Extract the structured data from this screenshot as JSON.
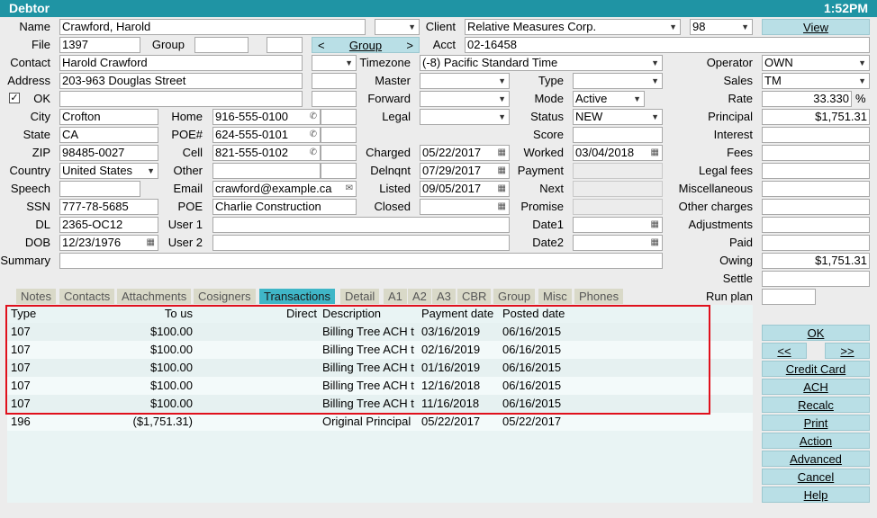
{
  "window": {
    "title": "Debtor",
    "clock": "1:52PM",
    "close": "×"
  },
  "labels": {
    "name": "Name",
    "file": "File",
    "group": "Group",
    "contact": "Contact",
    "address": "Address",
    "ok": "OK",
    "city": "City",
    "state": "State",
    "zip": "ZIP",
    "country": "Country",
    "speech": "Speech",
    "ssn": "SSN",
    "dl": "DL",
    "dob": "DOB",
    "summary": "Summary",
    "home": "Home",
    "poe_num": "POE#",
    "cell": "Cell",
    "other": "Other",
    "email": "Email",
    "poe": "POE",
    "user1": "User 1",
    "user2": "User 2",
    "client": "Client",
    "acct": "Acct",
    "timezone": "Timezone",
    "master": "Master",
    "forward": "Forward",
    "legal": "Legal",
    "charged": "Charged",
    "delnqnt": "Delnqnt",
    "listed": "Listed",
    "closed": "Closed",
    "type": "Type",
    "mode": "Mode",
    "status": "Status",
    "score": "Score",
    "worked": "Worked",
    "payment": "Payment",
    "next": "Next",
    "promise": "Promise",
    "date1": "Date1",
    "date2": "Date2",
    "operator": "Operator",
    "sales": "Sales",
    "rate": "Rate",
    "principal": "Principal",
    "interest": "Interest",
    "fees": "Fees",
    "legal_fees": "Legal fees",
    "miscellaneous": "Miscellaneous",
    "other_charges": "Other charges",
    "adjustments": "Adjustments",
    "paid": "Paid",
    "owing": "Owing",
    "settle": "Settle",
    "run_plan": "Run plan",
    "percent": "%"
  },
  "fields": {
    "name": "Crawford, Harold",
    "file": "1397",
    "contact": "Harold Crawford",
    "address": "203-963 Douglas Street",
    "city": "Crofton",
    "state": "CA",
    "zip": "98485-0027",
    "country": "United States",
    "ssn": "777-78-5685",
    "dl": "2365-OC12",
    "dob": "12/23/1976",
    "home": "916-555-0100",
    "poe_num": "624-555-0101",
    "cell": "821-555-0102",
    "email": "crawford@example.ca",
    "poe": "Charlie Construction",
    "client": "Relative Measures Corp.",
    "client_code": "98",
    "acct": "02-16458",
    "timezone": "(-8) Pacific Standard Time",
    "charged": "05/22/2017",
    "delnqnt": "07/29/2017",
    "listed": "09/05/2017",
    "mode": "Active",
    "status": "NEW",
    "worked": "03/04/2018",
    "operator": "OWN",
    "sales": "TM",
    "rate": "33.330",
    "principal": "$1,751.31",
    "owing": "$1,751.31"
  },
  "buttons": {
    "view": "View",
    "group_prev": "<",
    "group": "Group",
    "group_next": ">",
    "ok": "OK",
    "prev": "<<",
    "next": ">>",
    "credit_card": "Credit Card",
    "ach": "ACH",
    "recalc": "Recalc",
    "print": "Print",
    "action": "Action",
    "advanced": "Advanced",
    "cancel": "Cancel",
    "help": "Help"
  },
  "tabs": [
    "Notes",
    "Contacts",
    "Attachments",
    "Cosigners",
    "Transactions",
    "Detail",
    "A1",
    "A2",
    "A3",
    "CBR",
    "Group",
    "Misc",
    "Phones"
  ],
  "transactions": {
    "columns": {
      "type": "Type",
      "to_us": "To us",
      "direct": "Direct",
      "description": "Description",
      "payment_date": "Payment date",
      "posted_date": "Posted date"
    },
    "rows": [
      {
        "type": "107",
        "to_us": "$100.00",
        "description": "Billing Tree ACH t",
        "payment_date": "03/16/2019",
        "posted_date": "06/16/2015"
      },
      {
        "type": "107",
        "to_us": "$100.00",
        "description": "Billing Tree ACH t",
        "payment_date": "02/16/2019",
        "posted_date": "06/16/2015"
      },
      {
        "type": "107",
        "to_us": "$100.00",
        "description": "Billing Tree ACH t",
        "payment_date": "01/16/2019",
        "posted_date": "06/16/2015"
      },
      {
        "type": "107",
        "to_us": "$100.00",
        "description": "Billing Tree ACH t",
        "payment_date": "12/16/2018",
        "posted_date": "06/16/2015"
      },
      {
        "type": "107",
        "to_us": "$100.00",
        "description": "Billing Tree ACH t",
        "payment_date": "11/16/2018",
        "posted_date": "06/16/2015"
      },
      {
        "type": "196",
        "to_us": "($1,751.31)",
        "description": "Original Principal",
        "payment_date": "05/22/2017",
        "posted_date": "05/22/2017"
      }
    ]
  },
  "icons": {
    "dropdown": "chevron-down-icon",
    "phone": "phone-icon",
    "calendar": "calendar-icon",
    "mail": "mail-icon"
  }
}
